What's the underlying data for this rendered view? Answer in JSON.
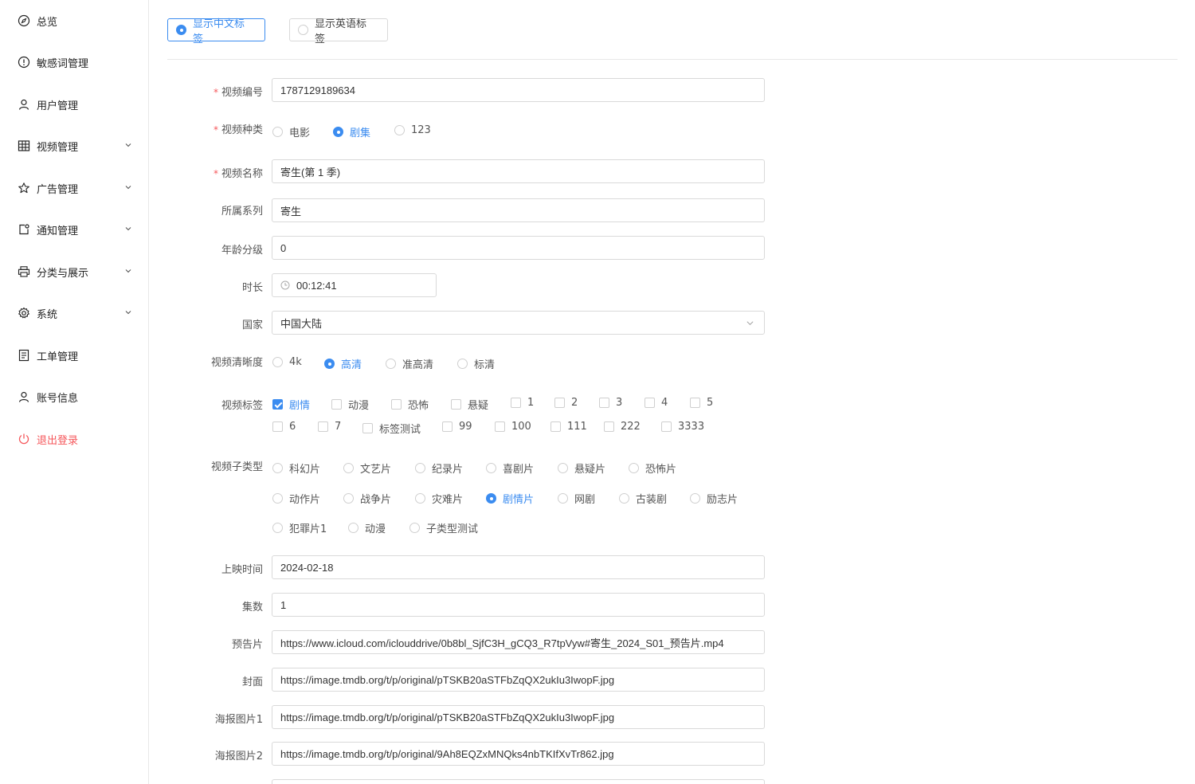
{
  "sidebar": {
    "items": [
      {
        "label": "总览",
        "icon": "compass-icon"
      },
      {
        "label": "敏感词管理",
        "icon": "alert-circle-icon"
      },
      {
        "label": "用户管理",
        "icon": "user-icon"
      },
      {
        "label": "视频管理",
        "icon": "table-icon",
        "expandable": true
      },
      {
        "label": "广告管理",
        "icon": "star-icon",
        "expandable": true
      },
      {
        "label": "通知管理",
        "icon": "notification-icon",
        "expandable": true
      },
      {
        "label": "分类与展示",
        "icon": "printer-icon",
        "expandable": true
      },
      {
        "label": "系统",
        "icon": "gear-icon",
        "expandable": true
      },
      {
        "label": "工单管理",
        "icon": "document-icon"
      },
      {
        "label": "账号信息",
        "icon": "user-icon"
      },
      {
        "label": "退出登录",
        "icon": "power-icon"
      }
    ]
  },
  "lang_toggle": {
    "chinese": "显示中文标签",
    "english": "显示英语标签",
    "selected": "chinese"
  },
  "form": {
    "video_id": {
      "label": "视频编号",
      "value": "1787129189634",
      "required": true
    },
    "video_kind": {
      "label": "视频种类",
      "required": true,
      "options": [
        "电影",
        "剧集",
        "123"
      ],
      "selected": "剧集"
    },
    "video_name": {
      "label": "视频名称",
      "value": "寄生(第 1 季)",
      "required": true
    },
    "series": {
      "label": "所属系列",
      "value": "寄生"
    },
    "age_rating": {
      "label": "年龄分级",
      "value": "0"
    },
    "duration": {
      "label": "时长",
      "value": "00:12:41"
    },
    "country": {
      "label": "国家",
      "value": "中国大陆"
    },
    "quality": {
      "label": "视频清晰度",
      "options": [
        "4k",
        "高清",
        "准高清",
        "标清"
      ],
      "selected": "高清"
    },
    "tags": {
      "label": "视频标签",
      "options": [
        "剧情",
        "动漫",
        "恐怖",
        "悬疑",
        "1",
        "2",
        "3",
        "4",
        "5",
        "6",
        "7",
        "标签测试",
        "99",
        "100",
        "111",
        "222",
        "3333"
      ],
      "checked": [
        "剧情"
      ]
    },
    "subtype": {
      "label": "视频子类型",
      "options": [
        "科幻片",
        "文艺片",
        "纪录片",
        "喜剧片",
        "悬疑片",
        "恐怖片",
        "动作片",
        "战争片",
        "灾难片",
        "剧情片",
        "网剧",
        "古装剧",
        "励志片",
        "犯罪片1",
        "动漫",
        "子类型测试"
      ],
      "selected": "剧情片"
    },
    "release_date": {
      "label": "上映时间",
      "value": "2024-02-18"
    },
    "episodes": {
      "label": "集数",
      "value": "1"
    },
    "trailer": {
      "label": "预告片",
      "value": "https://www.icloud.com/iclouddrive/0b8bl_SjfC3H_gCQ3_R7tpVyw#寄生_2024_S01_预告片.mp4"
    },
    "cover": {
      "label": "封面",
      "value": "https://image.tmdb.org/t/p/original/pTSKB20aSTFbZqQX2ukIu3IwopF.jpg"
    },
    "poster1": {
      "label": "海报图片1",
      "value": "https://image.tmdb.org/t/p/original/pTSKB20aSTFbZqQX2ukIu3IwopF.jpg"
    },
    "poster2": {
      "label": "海报图片2",
      "value": "https://image.tmdb.org/t/p/original/9Ah8EQZxMNQks4nbTKIfXvTr862.jpg"
    }
  },
  "colors": {
    "accent": "#3b8cf0",
    "danger": "#f5565a",
    "border": "#d9d9d9"
  }
}
